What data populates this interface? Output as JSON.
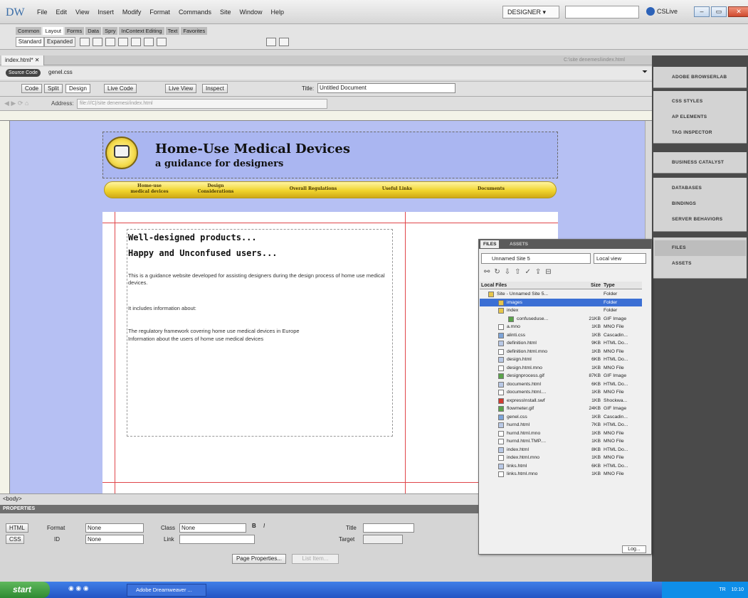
{
  "menubar": {
    "logo": "DW",
    "items": [
      "File",
      "Edit",
      "View",
      "Insert",
      "Modify",
      "Format",
      "Commands",
      "Site",
      "Window",
      "Help"
    ],
    "workspace": "DESIGNER",
    "cslive": "CSLive"
  },
  "insert_bar": {
    "tabs": [
      "Common",
      "Layout",
      "Forms",
      "Data",
      "Spry",
      "InContext Editing",
      "Text",
      "Favorites"
    ],
    "active_tab": "Layout",
    "standard": "Standard",
    "expanded": "Expanded"
  },
  "document": {
    "tab_label": "index.html*",
    "path": "C:\\site denemesi\\index.html",
    "related_file_badge": "Source Code",
    "related_file": "genel.css",
    "view_buttons": [
      "Code",
      "Split",
      "Design"
    ],
    "live_code": "Live Code",
    "live_view": "Live View",
    "inspect": "Inspect",
    "title_label": "Title:",
    "title_value": "Untitled Document",
    "address_label": "Address:",
    "address_value": "file:///C|/site denemesi/index.html"
  },
  "page": {
    "site_title": "Home-Use Medical Devices",
    "site_subtitle": "a guidance for designers",
    "nav": [
      "Home-use medical devices",
      "Design Considerations",
      "Overall Regulations",
      "Useful Links",
      "Documents"
    ],
    "heading1": "Well-designed products...",
    "heading2": "Happy and Unconfused users...",
    "para1": "This is a guidance website developed for assisting designers during the design process of home use medical devices.",
    "para2": "It includes information about:",
    "para3": "The regulatory framework covering home use medical devices in Europe",
    "para4": "Information about the users of home use medical devices"
  },
  "statusbar": {
    "tag": "<body>"
  },
  "properties": {
    "header": "PROPERTIES",
    "html_btn": "HTML",
    "css_btn": "CSS",
    "format_label": "Format",
    "format_value": "None",
    "class_label": "Class",
    "class_value": "None",
    "id_label": "ID",
    "id_value": "None",
    "link_label": "Link",
    "title_label": "Title",
    "target_label": "Target",
    "page_properties": "Page Properties...",
    "list_item": "List Item..."
  },
  "dock": {
    "items": [
      "ADOBE BROWSERLAB",
      "CSS STYLES",
      "AP ELEMENTS",
      "TAG INSPECTOR",
      "BUSINESS CATALYST",
      "DATABASES",
      "BINDINGS",
      "SERVER BEHAVIORS",
      "FILES",
      "ASSETS"
    ]
  },
  "files_panel": {
    "tab_files": "FILES",
    "tab_assets": "ASSETS",
    "site": "Unnamed Site 5",
    "view": "Local view",
    "col_local": "Local Files",
    "col_size": "Size",
    "col_type": "Type",
    "log_btn": "Log...",
    "rows": [
      {
        "name": "Site - Unnamed Site 5...",
        "size": "",
        "type": "Folder",
        "indent": 0,
        "icon": "folder"
      },
      {
        "name": "images",
        "size": "",
        "type": "Folder",
        "indent": 1,
        "icon": "folder",
        "selected": true
      },
      {
        "name": "index",
        "size": "",
        "type": "Folder",
        "indent": 1,
        "icon": "folder"
      },
      {
        "name": "confuseduse...",
        "size": "21KB",
        "type": "GIF Image",
        "indent": 2,
        "icon": "image"
      },
      {
        "name": "a.mno",
        "size": "1KB",
        "type": "MNO File",
        "indent": 1,
        "icon": "file"
      },
      {
        "name": "alinti.css",
        "size": "1KB",
        "type": "Cascadin...",
        "indent": 1,
        "icon": "css"
      },
      {
        "name": "definition.html",
        "size": "9KB",
        "type": "HTML Do...",
        "indent": 1,
        "icon": "html"
      },
      {
        "name": "definition.html.mno",
        "size": "1KB",
        "type": "MNO File",
        "indent": 1,
        "icon": "file"
      },
      {
        "name": "design.html",
        "size": "6KB",
        "type": "HTML Do...",
        "indent": 1,
        "icon": "html"
      },
      {
        "name": "design.html.mno",
        "size": "1KB",
        "type": "MNO File",
        "indent": 1,
        "icon": "file"
      },
      {
        "name": "designprocess.gif",
        "size": "87KB",
        "type": "GIF Image",
        "indent": 1,
        "icon": "image"
      },
      {
        "name": "documents.html",
        "size": "6KB",
        "type": "HTML Do...",
        "indent": 1,
        "icon": "html"
      },
      {
        "name": "documents.html....",
        "size": "1KB",
        "type": "MNO File",
        "indent": 1,
        "icon": "file"
      },
      {
        "name": "expressInstall.swf",
        "size": "1KB",
        "type": "Shockwa...",
        "indent": 1,
        "icon": "swf"
      },
      {
        "name": "flowmeter.gif",
        "size": "24KB",
        "type": "GIF Image",
        "indent": 1,
        "icon": "image"
      },
      {
        "name": "genel.css",
        "size": "1KB",
        "type": "Cascadin...",
        "indent": 1,
        "icon": "css"
      },
      {
        "name": "hurnd.html",
        "size": "7KB",
        "type": "HTML Do...",
        "indent": 1,
        "icon": "html"
      },
      {
        "name": "hurnd.html.mno",
        "size": "1KB",
        "type": "MNO File",
        "indent": 1,
        "icon": "file"
      },
      {
        "name": "hurnd.html.TMP....",
        "size": "1KB",
        "type": "MNO File",
        "indent": 1,
        "icon": "file"
      },
      {
        "name": "index.html",
        "size": "8KB",
        "type": "HTML Do...",
        "indent": 1,
        "icon": "html"
      },
      {
        "name": "index.html.mno",
        "size": "1KB",
        "type": "MNO File",
        "indent": 1,
        "icon": "file"
      },
      {
        "name": "links.html",
        "size": "6KB",
        "type": "HTML Do...",
        "indent": 1,
        "icon": "html"
      },
      {
        "name": "links.html.mno",
        "size": "1KB",
        "type": "MNO File",
        "indent": 1,
        "icon": "file"
      }
    ]
  },
  "taskbar": {
    "start": "start",
    "task": "Adobe Dreamweaver ...",
    "tray_lang": "TR",
    "clock": "10:10"
  },
  "colors": {
    "design_bg": "#b6c0f3",
    "nav_yellow": "#f0d42d",
    "selection": "#3b6fd4",
    "guide_red": "#e0454a"
  }
}
